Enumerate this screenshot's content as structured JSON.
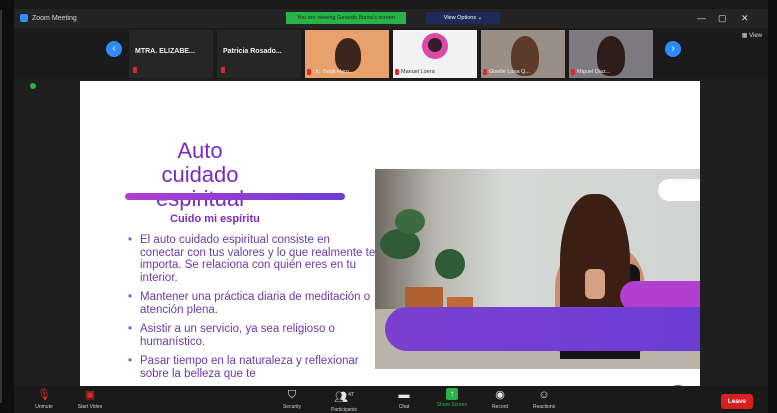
{
  "window": {
    "title": "Zoom Meeting",
    "banner": "You are viewing Gerardo Ibarra's screen",
    "view_options": "View Options ⌄",
    "controls": [
      "—",
      "▢",
      "✕"
    ]
  },
  "gallery": {
    "participants": [
      {
        "name": "MTRA. ELIZABE..."
      },
      {
        "name": "Patricia Rosado..."
      },
      {
        "name": "Lic. Bepti Hern..."
      },
      {
        "name": "Manuel Loera"
      },
      {
        "name": "Giselle Luna Q..."
      },
      {
        "name": "Miguel Diaz..."
      }
    ],
    "view_label": "View"
  },
  "slide": {
    "title_line1": "Auto cuidado",
    "title_line2": "espiritual",
    "subtitle": "Cuido mi espíritu",
    "bullets": [
      "El auto cuidado espiritual consiste en conectar con tus valores y lo que realmente te importa. Se relaciona con quién eres en tu interior.",
      "Mantener una práctica diaria de meditación o atención plena.",
      "Asistir a un servicio, ya sea religioso o humanístico.",
      "Pasar tiempo en la naturaleza y reflexionar sobre la belleza que te"
    ]
  },
  "toolbar": {
    "unmute": "Unmute",
    "start_video": "Start Video",
    "security": "Security",
    "participants": "Participants",
    "participant_count": "47",
    "chat": "Chat",
    "share_screen": "Share Screen",
    "record": "Record",
    "reactions": "Reactions",
    "leave": "Leave"
  },
  "colors": {
    "accent_blue": "#2d8cff",
    "share_green": "#2bb34a",
    "leave_red": "#d92020",
    "slide_purple": "#7a2cbf"
  }
}
